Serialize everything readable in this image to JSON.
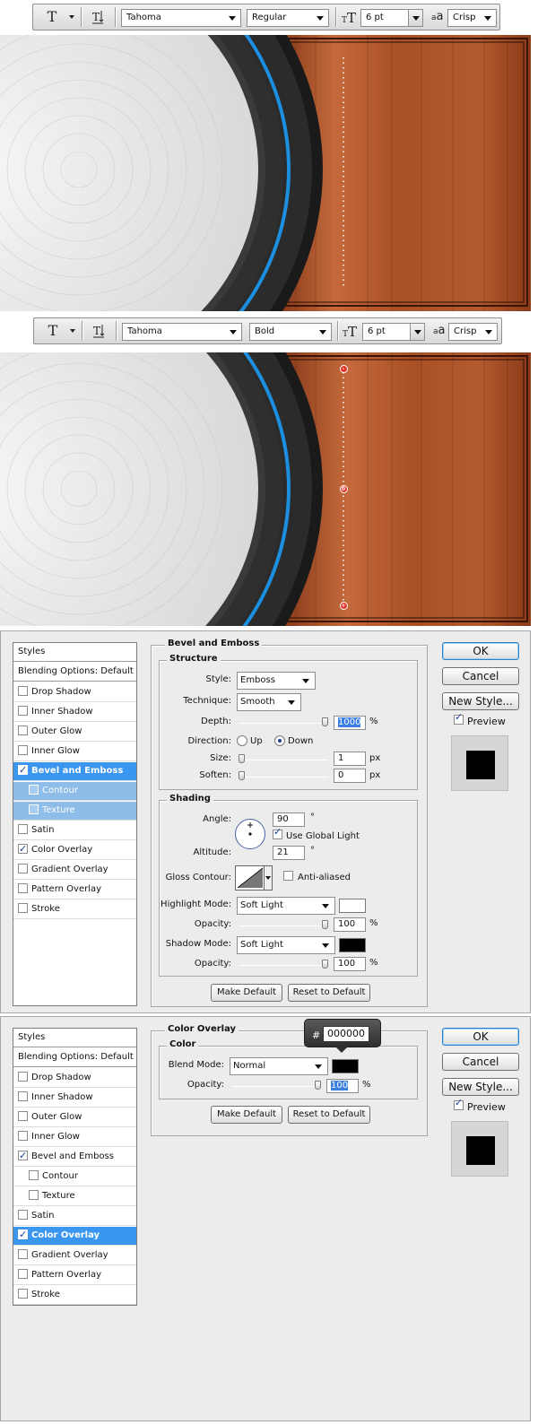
{
  "toolbar1": {
    "font_family": "Tahoma",
    "font_style": "Regular",
    "font_size": "6 pt",
    "antialias": "Crisp"
  },
  "toolbar2": {
    "font_family": "Tahoma",
    "font_style": "Bold",
    "font_size": "6 pt",
    "antialias": "Crisp"
  },
  "toolbar_icons": {
    "type_tool": "T",
    "aa_glyph": "a",
    "aa_glyph2": "a"
  },
  "knobs": {
    "minus": "-",
    "zero": "0",
    "plus": "+"
  },
  "colors": {
    "wood": "#b45a30",
    "accent_blue": "#1c8fe0",
    "selection": "#3b96f0",
    "knob_red": "#e0332a"
  },
  "styles_list": {
    "header": "Styles",
    "blending": "Blending Options: Default",
    "items": [
      {
        "label": "Drop Shadow",
        "checked": false
      },
      {
        "label": "Inner Shadow",
        "checked": false
      },
      {
        "label": "Outer Glow",
        "checked": false
      },
      {
        "label": "Inner Glow",
        "checked": false
      },
      {
        "label": "Bevel and Emboss",
        "checked": true
      },
      {
        "label": "Contour",
        "checked": false
      },
      {
        "label": "Texture",
        "checked": false
      },
      {
        "label": "Satin",
        "checked": false
      },
      {
        "label": "Color Overlay",
        "checked": true
      },
      {
        "label": "Gradient Overlay",
        "checked": false
      },
      {
        "label": "Pattern Overlay",
        "checked": false
      },
      {
        "label": "Stroke",
        "checked": false
      }
    ]
  },
  "bevel": {
    "title": "Bevel and Emboss",
    "structure": {
      "title": "Structure",
      "style_label": "Style:",
      "style_value": "Emboss",
      "technique_label": "Technique:",
      "technique_value": "Smooth",
      "depth_label": "Depth:",
      "depth_value": "1000",
      "depth_unit": "%",
      "depth_level": 1.0,
      "direction_label": "Direction:",
      "dir_up": "Up",
      "dir_down": "Down",
      "size_label": "Size:",
      "size_value": "1",
      "size_unit": "px",
      "size_level": 0.0,
      "soften_label": "Soften:",
      "soften_value": "0",
      "soften_unit": "px",
      "soften_level": 0.0
    },
    "shading": {
      "title": "Shading",
      "angle_label": "Angle:",
      "angle_value": "90",
      "angle_unit": "°",
      "global_light": "Use Global Light",
      "altitude_label": "Altitude:",
      "altitude_value": "21",
      "altitude_unit": "°",
      "gloss_label": "Gloss Contour:",
      "antialiased": "Anti-aliased",
      "highlight_label": "Highlight Mode:",
      "highlight_value": "Soft Light",
      "hl_opacity_label": "Opacity:",
      "hl_opacity_value": "100",
      "hl_opacity_unit": "%",
      "hl_level": 1.0,
      "shadow_label": "Shadow Mode:",
      "shadow_value": "Soft Light",
      "sh_opacity_label": "Opacity:",
      "sh_opacity_value": "100",
      "sh_opacity_unit": "%",
      "sh_level": 1.0,
      "highlight_color": "#ffffff",
      "shadow_color": "#000000"
    },
    "make_default": "Make Default",
    "reset_default": "Reset to Default"
  },
  "overlay": {
    "title": "Color Overlay",
    "color_title": "Color",
    "blend_label": "Blend Mode:",
    "blend_value": "Normal",
    "opacity_label": "Opacity:",
    "opacity_value": "100",
    "opacity_unit": "%",
    "opacity_level": 1.0,
    "color_hex": "000000",
    "hash": "#",
    "make_default": "Make Default",
    "reset_default": "Reset to Default"
  },
  "side": {
    "ok": "OK",
    "cancel": "Cancel",
    "new_style": "New Style...",
    "preview": "Preview"
  }
}
